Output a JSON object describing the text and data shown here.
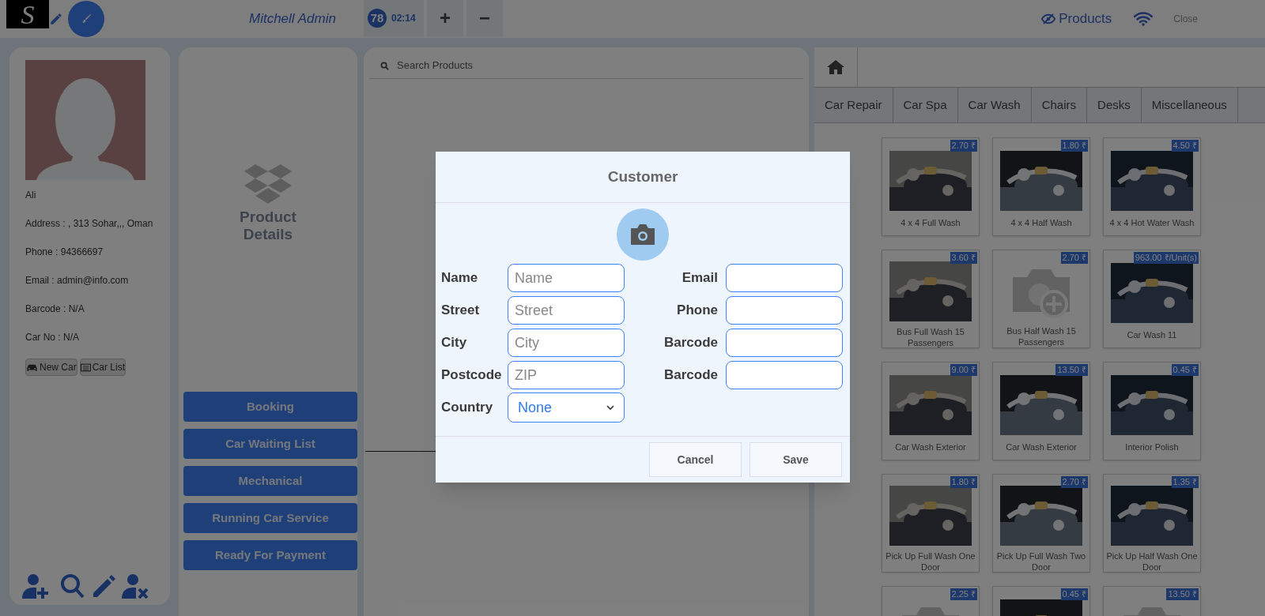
{
  "topbar": {
    "logo_text": "S",
    "user": "Mitchell Admin",
    "order_badge": "78",
    "order_time": "02:14",
    "add_button": "+",
    "remove_button": "−",
    "products_toggle": "Products",
    "close": "Close"
  },
  "customer_panel": {
    "name": "Ali",
    "lines": [
      "Address : , 313 Sohar,,, Oman",
      "Phone : 94366697",
      "Email : admin@info.com",
      "Barcode : N/A",
      "Car No : N/A"
    ],
    "buttons": [
      "New Car",
      "Car List"
    ]
  },
  "product_details": {
    "title": "Product Details"
  },
  "actions": [
    "Booking",
    "Car Waiting List",
    "Mechanical",
    "Running Car Service",
    "Ready For Payment"
  ],
  "search": {
    "placeholder": "Search Products"
  },
  "categories": [
    "Car Repair",
    "Car Spa",
    "Car Wash",
    "Chairs",
    "Desks",
    "Miscellaneous"
  ],
  "products": [
    {
      "name": "4 x 4 Full Wash",
      "price": "2.70 ₹",
      "kind": "picture"
    },
    {
      "name": "4 x 4 Half Wash",
      "price": "1.80 ₹",
      "kind": "picture"
    },
    {
      "name": "4 x 4 Hot Water Wash",
      "price": "4.50 ₹",
      "kind": "picture"
    },
    {
      "name": "Bus Full Wash 15 Passengers",
      "price": "3.60 ₹",
      "kind": "picture"
    },
    {
      "name": "Bus Half Wash 15 Passengers",
      "price": "2.70 ₹",
      "kind": "placeholder"
    },
    {
      "name": "Car Wash 11",
      "price": "963.00 ₹/Unit(s)",
      "kind": "picture"
    },
    {
      "name": "Car Wash Exterior",
      "price": "9.00 ₹",
      "kind": "picture"
    },
    {
      "name": "Car Wash Exterior",
      "price": "13.50 ₹",
      "kind": "picture"
    },
    {
      "name": "Interior Polish",
      "price": "0.45 ₹",
      "kind": "picture"
    },
    {
      "name": "Pick Up Full Wash One Door",
      "price": "1.80 ₹",
      "kind": "picture"
    },
    {
      "name": "Pick Up Full Wash Two Door",
      "price": "2.70 ₹",
      "kind": "picture"
    },
    {
      "name": "Pick Up Half Wash One Door",
      "price": "1.35 ₹",
      "kind": "picture"
    },
    {
      "price": "2.25 ₹",
      "kind": "placeholder"
    },
    {
      "price": "0.45 ₹",
      "kind": "picture"
    },
    {
      "price": "13.50 ₹",
      "kind": "placeholder"
    }
  ],
  "modal": {
    "title": "Customer",
    "left_fields": [
      {
        "label": "Name",
        "placeholder": "Name",
        "kind": "input"
      },
      {
        "label": "Street",
        "placeholder": "Street",
        "kind": "input"
      },
      {
        "label": "City",
        "placeholder": "City",
        "kind": "input"
      },
      {
        "label": "Postcode",
        "placeholder": "ZIP",
        "kind": "input"
      },
      {
        "label": "Country",
        "value": "None",
        "kind": "select"
      }
    ],
    "right_fields": [
      {
        "label": "Email",
        "kind": "input"
      },
      {
        "label": "Phone",
        "kind": "input"
      },
      {
        "label": "Barcode",
        "kind": "input"
      },
      {
        "label": "Barcode",
        "kind": "input"
      }
    ],
    "buttons": [
      "Cancel",
      "Save"
    ]
  }
}
